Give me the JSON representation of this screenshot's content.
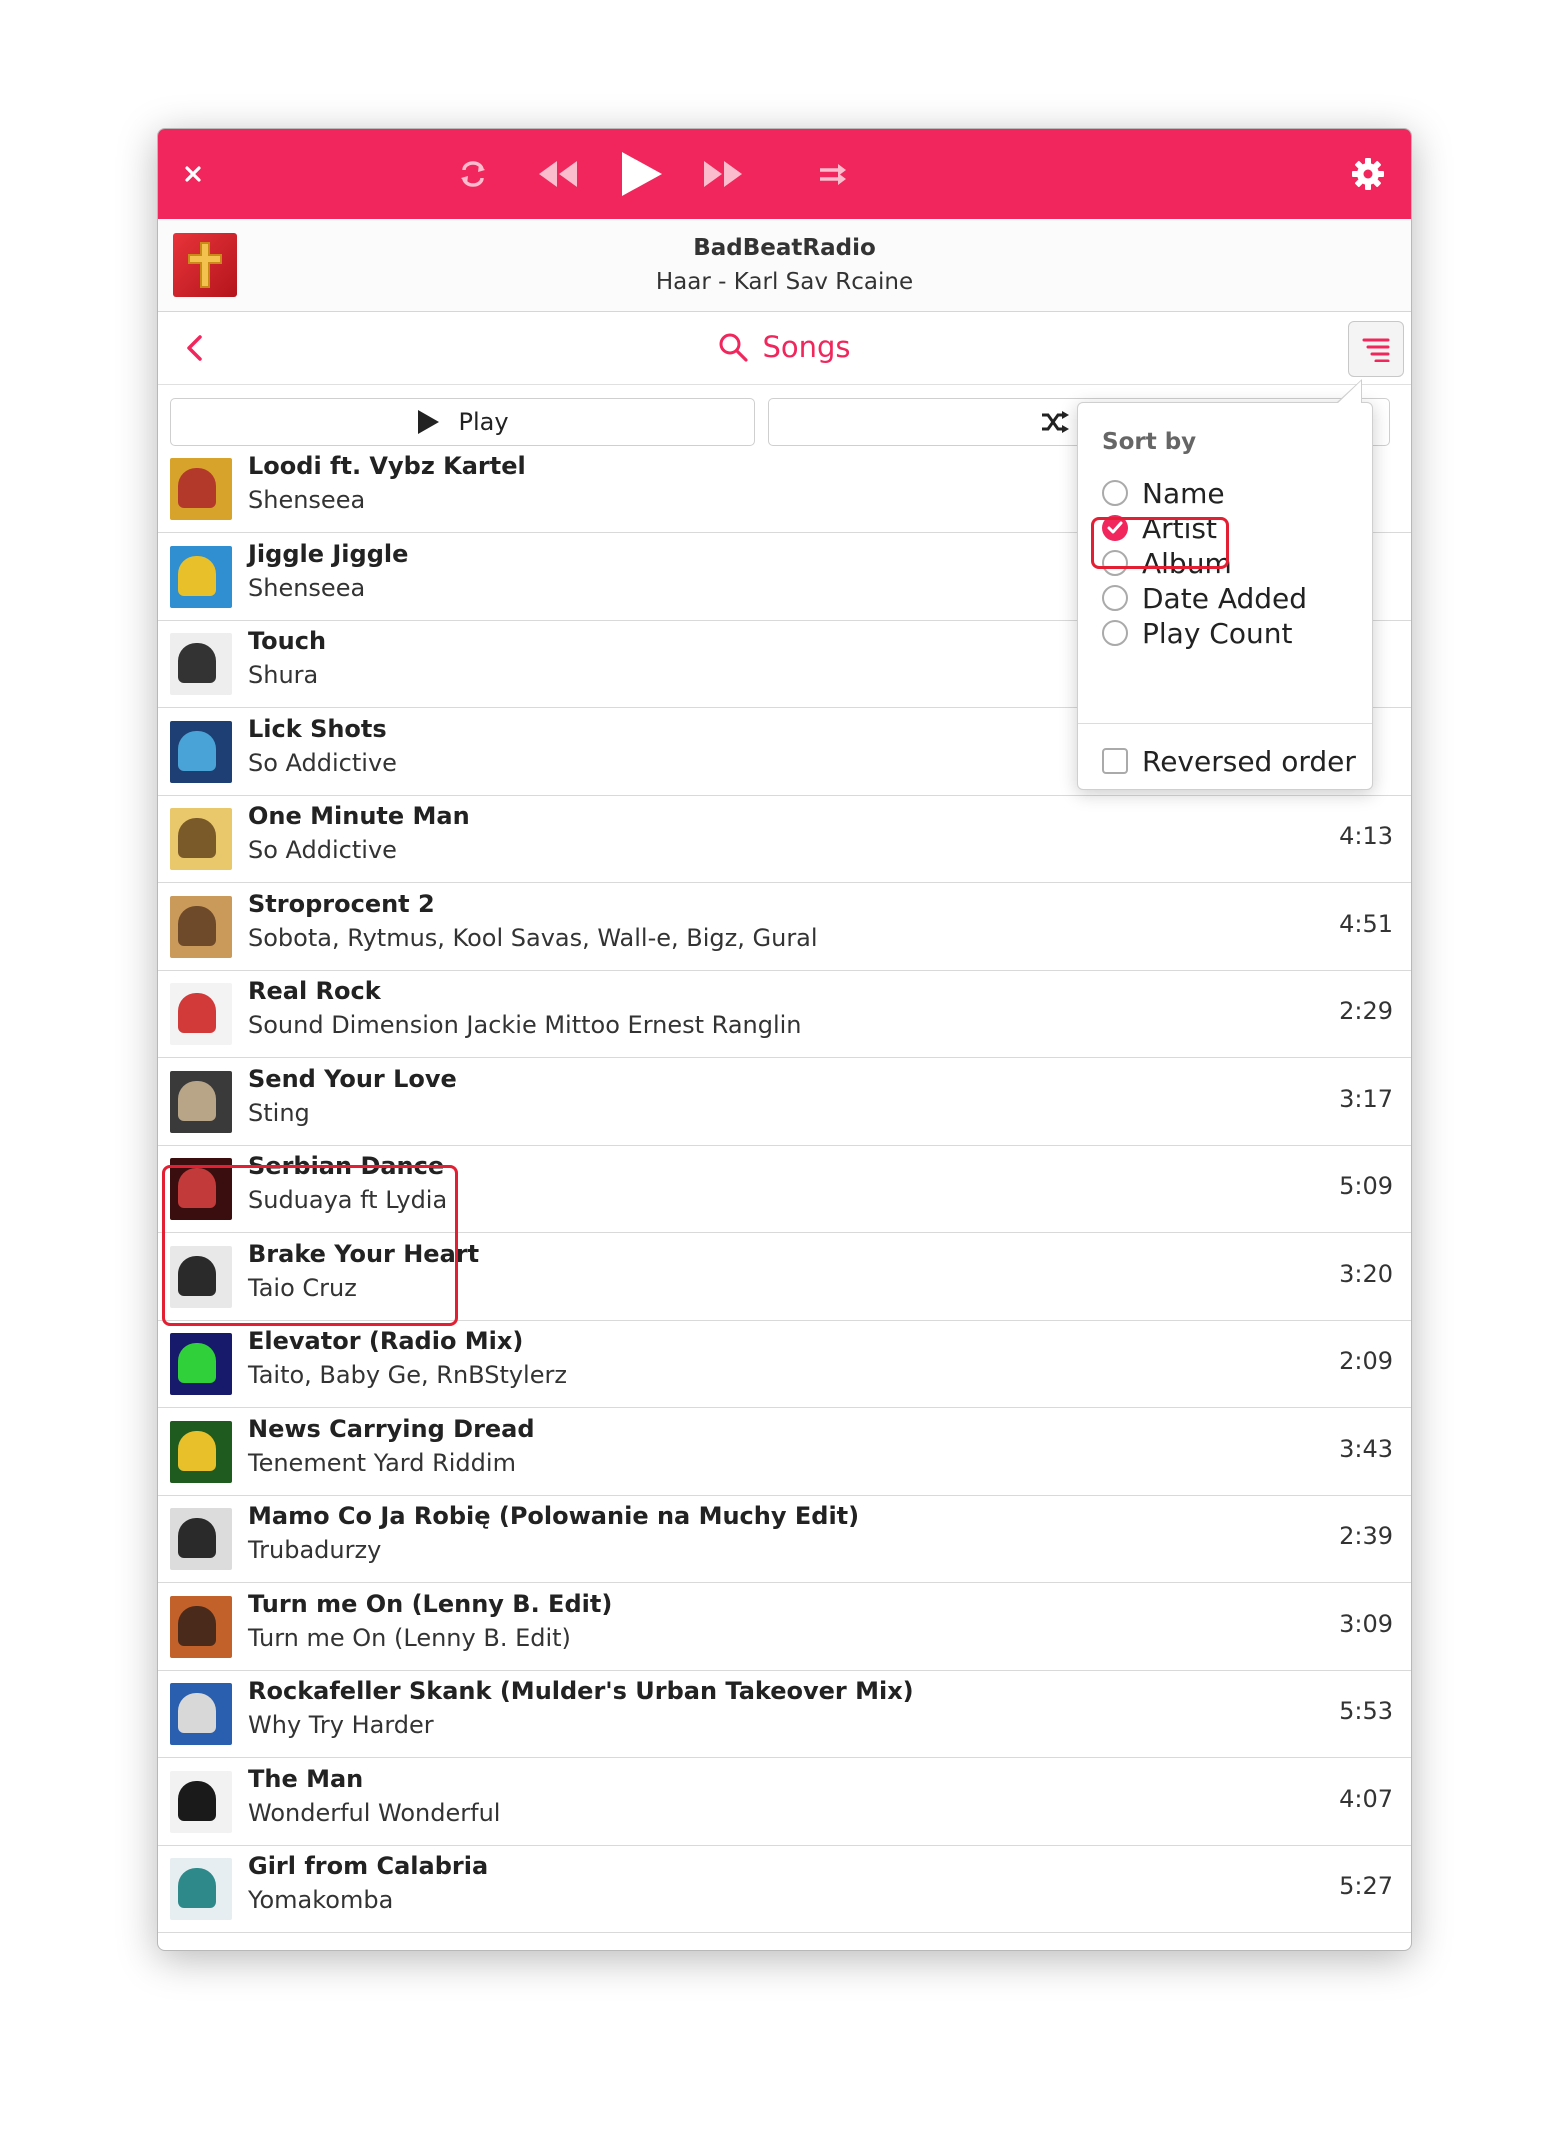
{
  "colors": {
    "accent": "#f0265c",
    "highlight": "#e32033"
  },
  "player": {
    "icons": [
      "close-icon",
      "repeat-icon",
      "rewind-icon",
      "play-icon",
      "fast-forward-icon",
      "shuffle-mode-icon",
      "gear-icon"
    ]
  },
  "now_playing": {
    "station": "BadBeatRadio",
    "track": "Haar - Karl Sav Rcaine"
  },
  "nav": {
    "title": "Songs"
  },
  "actions": {
    "play_label": "Play",
    "shuffle_label": "Sh"
  },
  "sort_menu": {
    "header": "Sort by",
    "options": [
      "Name",
      "Artist",
      "Album",
      "Date Added",
      "Play Count"
    ],
    "selected": "Artist",
    "reversed_label": "Reversed order",
    "reversed_checked": false
  },
  "songs": [
    {
      "title": "Loodi ft. Vybz Kartel",
      "artist": "Shenseea",
      "duration": "",
      "c1": "#d8a32a",
      "c2": "#b33a2a"
    },
    {
      "title": "Jiggle Jiggle",
      "artist": "Shenseea",
      "duration": "",
      "c1": "#2f8fd0",
      "c2": "#e8c02a"
    },
    {
      "title": "Touch",
      "artist": "Shura",
      "duration": "",
      "c1": "#eeeeee",
      "c2": "#333333"
    },
    {
      "title": "Lick Shots",
      "artist": "So Addictive",
      "duration": "",
      "c1": "#1d3f73",
      "c2": "#4aa3d6"
    },
    {
      "title": "One Minute Man",
      "artist": "So Addictive",
      "duration": "4:13",
      "c1": "#e9c76b",
      "c2": "#7b5a2a"
    },
    {
      "title": "Stroprocent 2",
      "artist": "Sobota, Rytmus, Kool Savas, Wall-e, Bigz, Gural",
      "duration": "4:51",
      "c1": "#c99a5a",
      "c2": "#6e4a2a"
    },
    {
      "title": "Real Rock",
      "artist": "Sound Dimension Jackie Mittoo Ernest Ranglin",
      "duration": "2:29",
      "c1": "#f3f3f3",
      "c2": "#d23a3a"
    },
    {
      "title": "Send Your Love",
      "artist": "Sting",
      "duration": "3:17",
      "c1": "#3a3a3a",
      "c2": "#b8a588"
    },
    {
      "title": "Serbian Dance",
      "artist": "Suduaya ft Lydia",
      "duration": "5:09",
      "c1": "#3a0e0e",
      "c2": "#c23a3a"
    },
    {
      "title": "Brake Your Heart",
      "artist": "Taio Cruz",
      "duration": "3:20",
      "c1": "#e8e8e8",
      "c2": "#2a2a2a"
    },
    {
      "title": "Elevator (Radio Mix)",
      "artist": "Taito, Baby Ge, RnBStylerz",
      "duration": "2:09",
      "c1": "#171a6b",
      "c2": "#2fd03a"
    },
    {
      "title": "News Carrying Dread",
      "artist": "Tenement Yard Riddim",
      "duration": "3:43",
      "c1": "#1f5a1f",
      "c2": "#e8c02a"
    },
    {
      "title": "Mamo Co Ja Robię (Polowanie na Muchy Edit)",
      "artist": "Trubadurzy",
      "duration": "2:39",
      "c1": "#dcdcdc",
      "c2": "#2a2a2a"
    },
    {
      "title": "Turn me On (Lenny B. Edit)",
      "artist": "Turn me On (Lenny B. Edit)",
      "duration": "3:09",
      "c1": "#c2612a",
      "c2": "#4a2a1a"
    },
    {
      "title": "Rockafeller Skank (Mulder's Urban Takeover Mix)",
      "artist": "Why Try Harder",
      "duration": "5:53",
      "c1": "#2a5fb0",
      "c2": "#d8d8d8"
    },
    {
      "title": "The Man",
      "artist": "Wonderful Wonderful",
      "duration": "4:07",
      "c1": "#f2f2f2",
      "c2": "#1a1a1a"
    },
    {
      "title": "Girl from Calabria",
      "artist": "Yomakomba",
      "duration": "5:27",
      "c1": "#e6eef2",
      "c2": "#2e8a8a"
    }
  ]
}
